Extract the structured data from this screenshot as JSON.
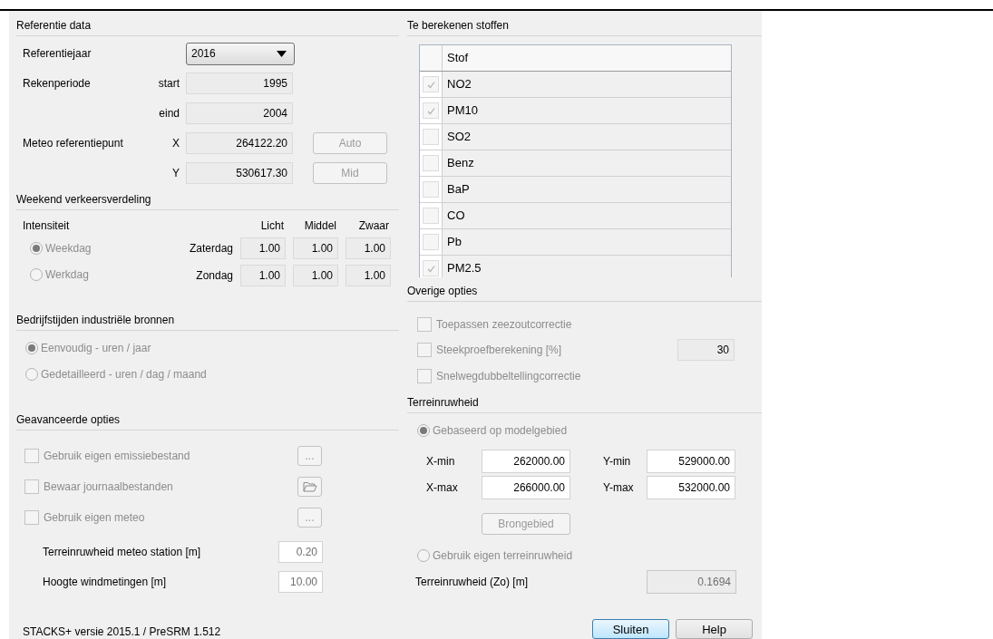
{
  "reference": {
    "title": "Referentie data",
    "year_label": "Referentiejaar",
    "year": "2016",
    "period_label": "Rekenperiode",
    "meteo_label": "Meteo referentiepunt",
    "fields": [
      {
        "label": "start",
        "value": "1995",
        "disabled": true
      },
      {
        "label": "eind",
        "value": "2004",
        "disabled": true
      },
      {
        "label": "X",
        "value": "264122.20",
        "disabled": true,
        "button": {
          "label": "Auto",
          "disabled": true
        }
      },
      {
        "label": "Y",
        "value": "530617.30",
        "disabled": true,
        "button": {
          "label": "Mid",
          "disabled": true
        }
      }
    ]
  },
  "weekend": {
    "title": "Weekend verkeersverdeling",
    "intensity_label": "Intensiteit",
    "columns": [
      "Licht",
      "Middel",
      "Zwaar"
    ],
    "radios": [
      {
        "label": "Weekdag",
        "selected": true,
        "disabled": true
      },
      {
        "label": "Werkdag",
        "selected": false,
        "disabled": true
      }
    ],
    "rows": [
      {
        "day": "Zaterdag",
        "values": [
          "1.00",
          "1.00",
          "1.00"
        ]
      },
      {
        "day": "Zondag",
        "values": [
          "1.00",
          "1.00",
          "1.00"
        ]
      }
    ]
  },
  "operating_hours": {
    "title": "Bedrijfstijden industriële bronnen",
    "options": [
      {
        "label": "Eenvoudig - uren / jaar",
        "selected": true,
        "disabled": true
      },
      {
        "label": "Gedetailleerd - uren / dag / maand",
        "selected": false,
        "disabled": true
      }
    ]
  },
  "advanced": {
    "title": "Geavanceerde opties",
    "options": [
      {
        "label": "Gebruik eigen emissiebestand",
        "checked": false,
        "disabled": true,
        "kind": "dots",
        "button": "..."
      },
      {
        "label": "Bewaar journaalbestanden",
        "checked": false,
        "disabled": true,
        "kind": "folder"
      },
      {
        "label": "Gebruik eigen meteo",
        "checked": false,
        "disabled": true,
        "kind": "dots",
        "button": "..."
      }
    ],
    "fields": [
      {
        "label": "Terreinruwheid meteo station [m]",
        "value": "0.20"
      },
      {
        "label": "Hoogte windmetingen [m]",
        "value": "10.00"
      }
    ]
  },
  "version": "STACKS+ versie 2015.1 / PreSRM 1.512",
  "substances": {
    "title": "Te berekenen stoffen",
    "column": "Stof",
    "rows": [
      {
        "name": "NO2",
        "checked": true
      },
      {
        "name": "PM10",
        "checked": true
      },
      {
        "name": "SO2",
        "checked": false
      },
      {
        "name": "Benz",
        "checked": false
      },
      {
        "name": "BaP",
        "checked": false
      },
      {
        "name": "CO",
        "checked": false
      },
      {
        "name": "Pb",
        "checked": false
      },
      {
        "name": "PM2.5",
        "checked": true
      }
    ]
  },
  "other_options": {
    "title": "Overige opties",
    "options": [
      {
        "label": "Toepassen zeezoutcorrectie",
        "checked": false,
        "disabled": true
      },
      {
        "label": "Steekproefberekening [%]",
        "checked": false,
        "disabled": true,
        "value": "30"
      },
      {
        "label": "Snelwegdubbeltellingcorrectie",
        "checked": false,
        "disabled": true
      }
    ]
  },
  "roughness": {
    "title": "Terreinruwheid",
    "modes": [
      {
        "label": "Gebaseerd op modelgebied",
        "selected": true,
        "disabled": true
      },
      {
        "label": "Gebruik eigen terreinruwheid",
        "selected": false,
        "disabled": true
      }
    ],
    "bounds": [
      {
        "label": "X-min",
        "value": "262000.00"
      },
      {
        "label": "Y-min",
        "value": "529000.00"
      },
      {
        "label": "X-max",
        "value": "266000.00"
      },
      {
        "label": "Y-max",
        "value": "532000.00"
      }
    ],
    "button": {
      "label": "Brongebied",
      "disabled": true
    },
    "result_label": "Terreinruwheid (Zo) [m]",
    "result": "0.1694"
  },
  "buttons": [
    {
      "label": "Sluiten",
      "default": true
    },
    {
      "label": "Help",
      "default": false
    }
  ]
}
